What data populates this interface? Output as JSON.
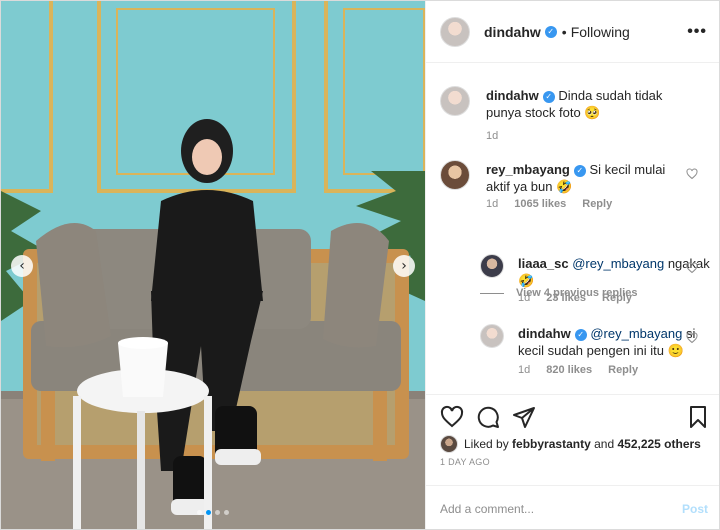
{
  "post": {
    "username": "dindahw",
    "follow_sep": "•",
    "follow_status": "Following",
    "more": "•••"
  },
  "photo": {
    "prev_icon": "chevron-left-icon",
    "next_icon": "chevron-right-icon",
    "slide_count": 4,
    "active_slide": 1,
    "colors": {
      "wall": "#7ecbd0",
      "sofa_frame": "#c8914e",
      "sofa_cushion": "#8a857c",
      "outfit": "#1a1a1a"
    }
  },
  "caption": {
    "username": "dindahw",
    "text": "Dinda sudah tidak punya stock foto 🥺",
    "time": "1d"
  },
  "comments": [
    {
      "username": "rey_mbayang",
      "text": "Si kecil mulai aktif ya bun 🤣",
      "time": "1d",
      "likes": "1065 likes",
      "reply": "Reply"
    }
  ],
  "view_previous": "View 4 previous replies",
  "replies": [
    {
      "username": "liaaa_sc",
      "mention": "@rey_mbayang",
      "text": "ngakak🤣",
      "time": "1d",
      "likes": "23 likes",
      "reply": "Reply"
    },
    {
      "username": "dindahw",
      "mention": "@rey_mbayang",
      "text": "si kecil sudah pengen ini itu 🙂",
      "time": "1d",
      "likes": "820 likes",
      "reply": "Reply"
    }
  ],
  "actions": {
    "liked_by_prefix": "Liked by",
    "liked_by_user": "febbyrastanty",
    "liked_by_and": "and",
    "liked_by_others": "452,225 others",
    "timestamp": "1 DAY AGO"
  },
  "comment_box": {
    "placeholder": "Add a comment...",
    "post_label": "Post"
  },
  "colors": {
    "accent": "#0095f6",
    "verified": "#3897f0",
    "muted": "#8e8e8e",
    "text": "#262626"
  }
}
